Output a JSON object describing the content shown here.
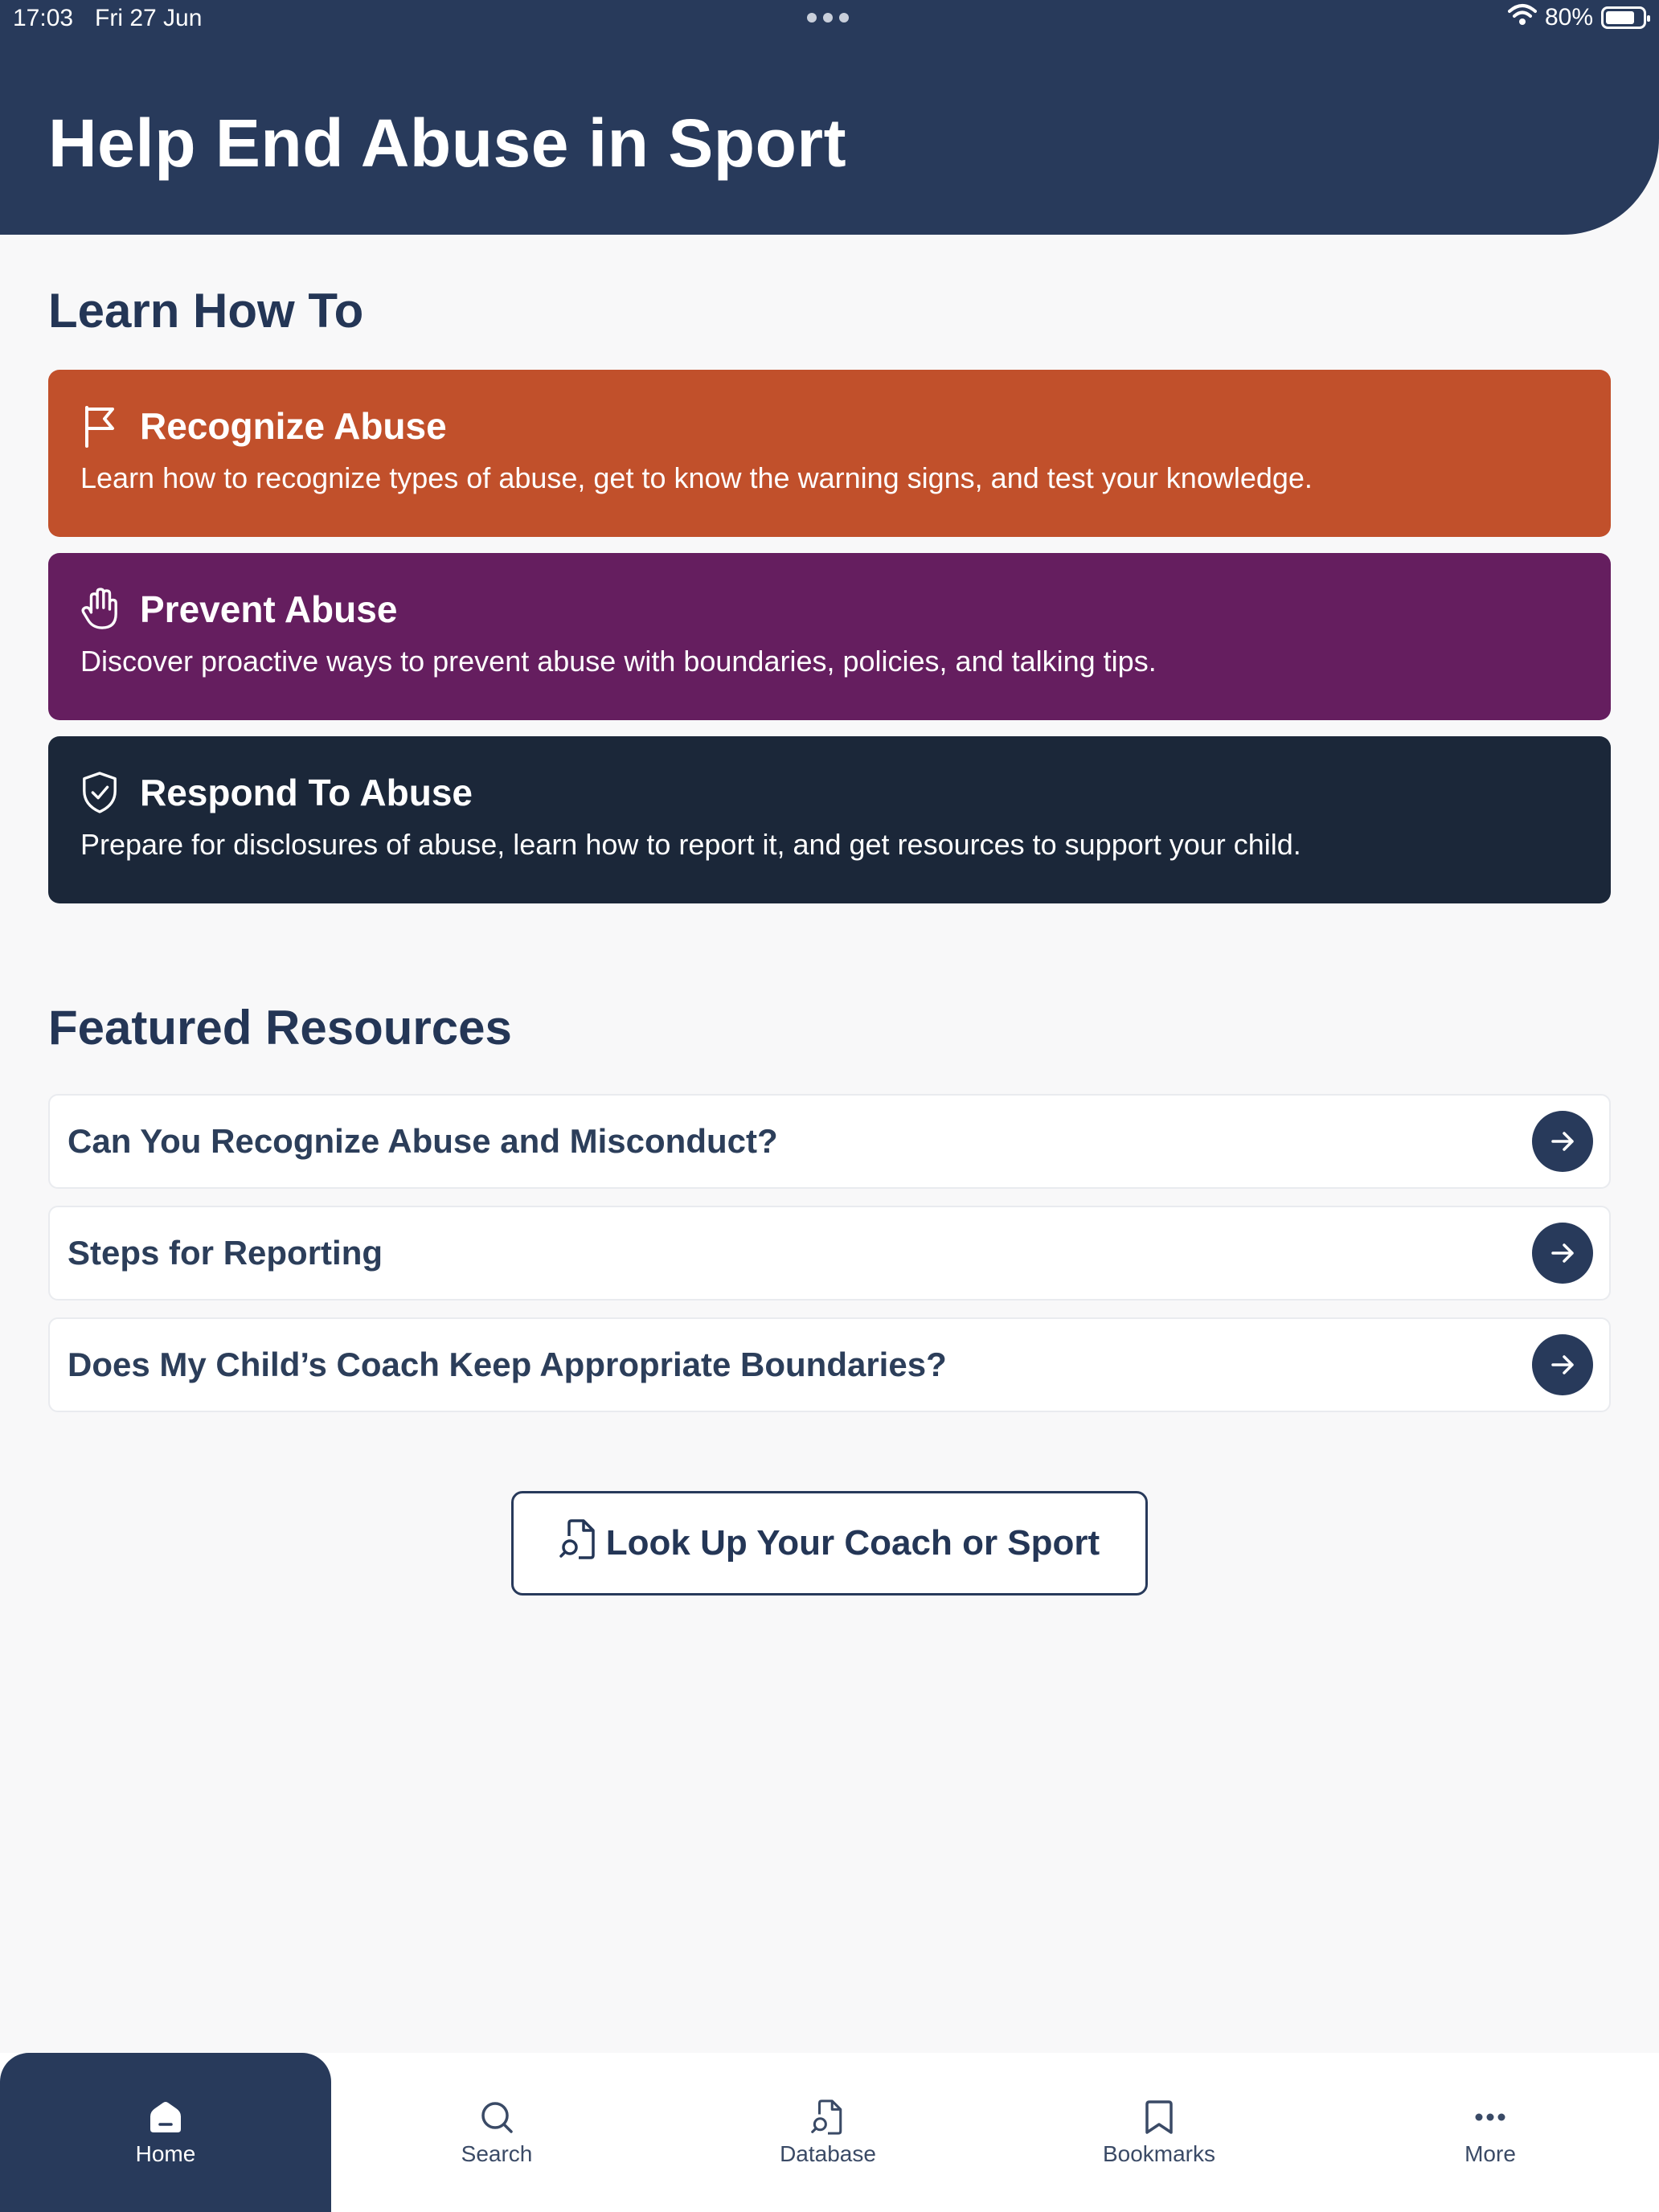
{
  "status": {
    "time": "17:03",
    "date": "Fri 27 Jun",
    "battery": "80%",
    "battery_level": 0.8
  },
  "header": {
    "title": "Help End Abuse in Sport"
  },
  "learn": {
    "title": "Learn How To",
    "cards": [
      {
        "title": "Recognize Abuse",
        "desc": "Learn how to recognize types of abuse, get to know the warning signs, and test your knowledge.",
        "color": "#c1502b",
        "icon": "flag-icon"
      },
      {
        "title": "Prevent Abuse",
        "desc": "Discover proactive ways to prevent abuse with boundaries, policies, and talking tips.",
        "color": "#651e5f",
        "icon": "hand-icon"
      },
      {
        "title": "Respond To Abuse",
        "desc": "Prepare for disclosures of abuse, learn how to report it, and get resources to support your child.",
        "color": "#1b2739",
        "icon": "shield-check-icon"
      }
    ]
  },
  "featured": {
    "title": "Featured Resources",
    "items": [
      {
        "label": "Can You Recognize Abuse and Misconduct?"
      },
      {
        "label": "Steps for Reporting"
      },
      {
        "label": "Does My Child’s Coach Keep Appropriate Boundaries?"
      }
    ]
  },
  "lookup": {
    "label": "Look Up Your Coach or Sport"
  },
  "nav": {
    "items": [
      {
        "label": "Home",
        "icon": "home-icon",
        "active": true
      },
      {
        "label": "Search",
        "icon": "search-icon",
        "active": false
      },
      {
        "label": "Database",
        "icon": "document-search-icon",
        "active": false
      },
      {
        "label": "Bookmarks",
        "icon": "bookmark-icon",
        "active": false
      },
      {
        "label": "More",
        "icon": "more-icon",
        "active": false
      }
    ]
  },
  "colors": {
    "navy": "#283a5b",
    "heading": "#243656"
  }
}
